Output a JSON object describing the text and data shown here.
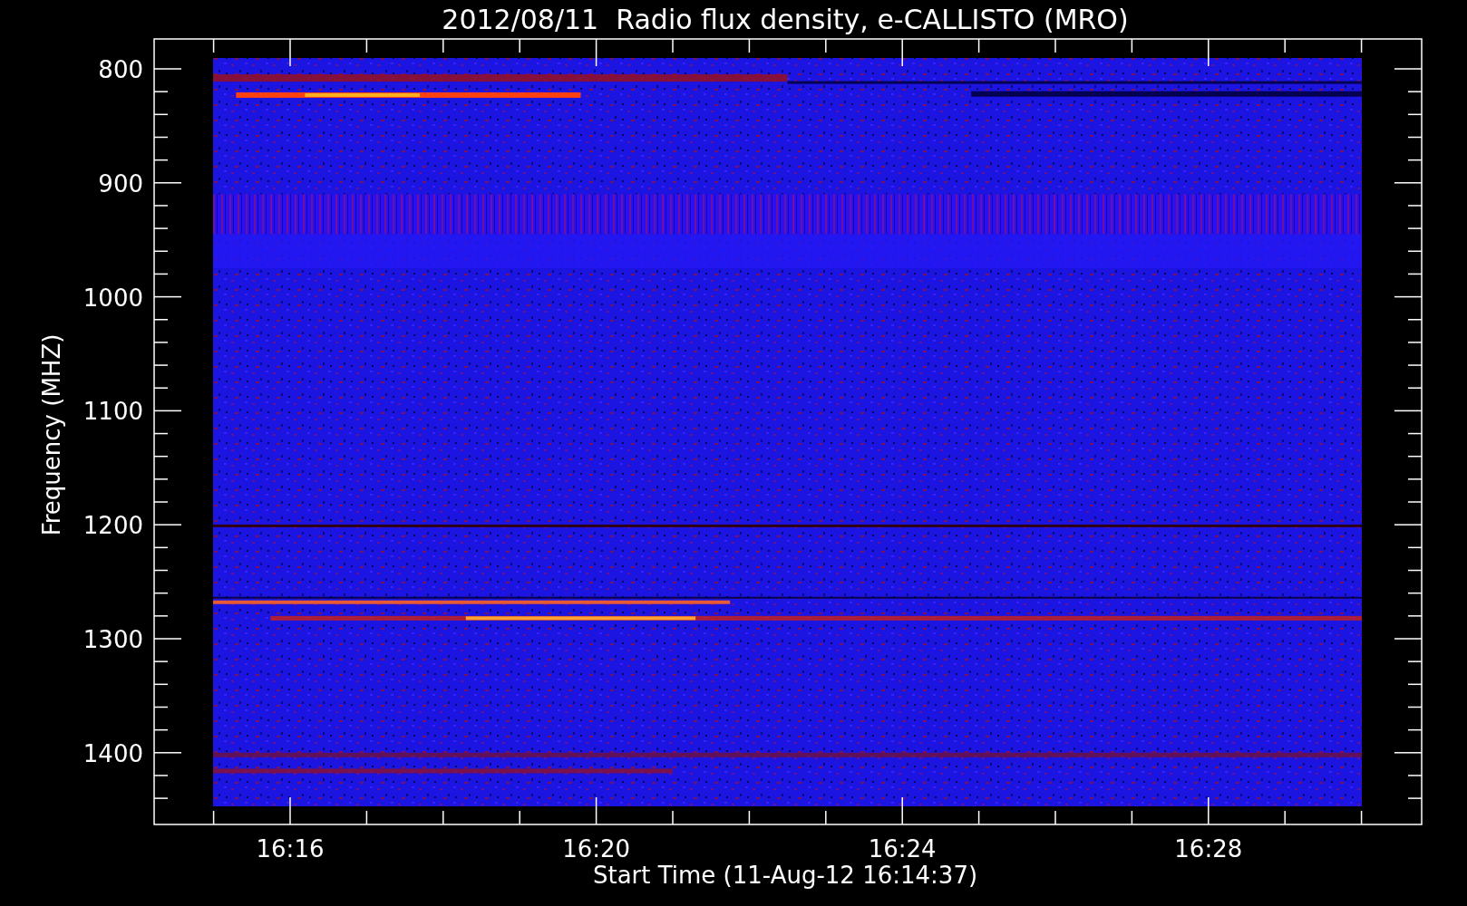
{
  "title": "2012/08/11  Radio flux density, e-CALLISTO (MRO)",
  "y_axis": {
    "label": "Frequency (MHZ)",
    "ticks": [
      "800",
      "900",
      "1000",
      "1100",
      "1200",
      "1300",
      "1400"
    ]
  },
  "x_axis": {
    "label": "Start Time (11-Aug-12 16:14:37)",
    "ticks": [
      "16:16",
      "16:20",
      "16:24",
      "16:28"
    ]
  }
}
